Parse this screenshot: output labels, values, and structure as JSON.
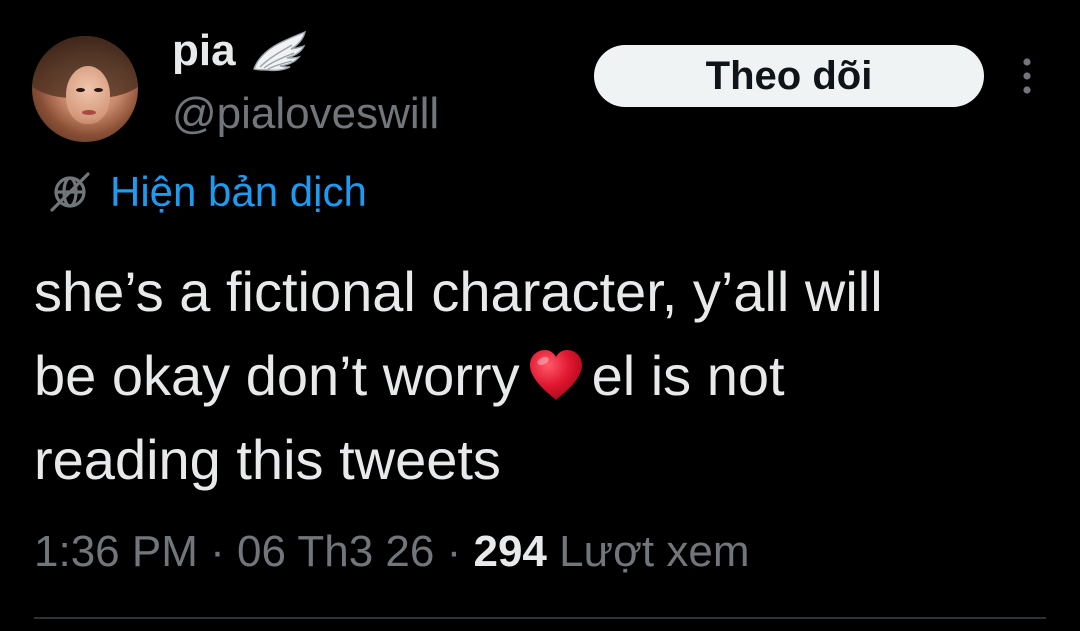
{
  "author": {
    "display_name": "pia",
    "handle": "@pialoveswill",
    "badge_icon": "angel-wing-icon"
  },
  "follow_button": {
    "label": "Theo dõi"
  },
  "more_menu_icon": "more-vertical-icon",
  "translate": {
    "icon": "globe-icon",
    "label": "Hiện bản dịch"
  },
  "tweet": {
    "text_line_1": "she’s a fictional character, y’all will",
    "text_line_2a": "be okay don’t worry",
    "heart_emoji": "❤️",
    "text_line_2b": "el is not",
    "text_line_3": "reading this tweets"
  },
  "meta": {
    "time": "1:36 PM",
    "separator": "·",
    "date": "06 Th3 26",
    "views_count": "294",
    "views_label": "Lượt xem"
  },
  "colors": {
    "background": "#000000",
    "text": "#e7e9ea",
    "secondary_text": "#71767b",
    "link": "#1d9bf0",
    "button_bg": "#eff3f4",
    "heart": "#e0172f",
    "divider": "#2f3336"
  }
}
